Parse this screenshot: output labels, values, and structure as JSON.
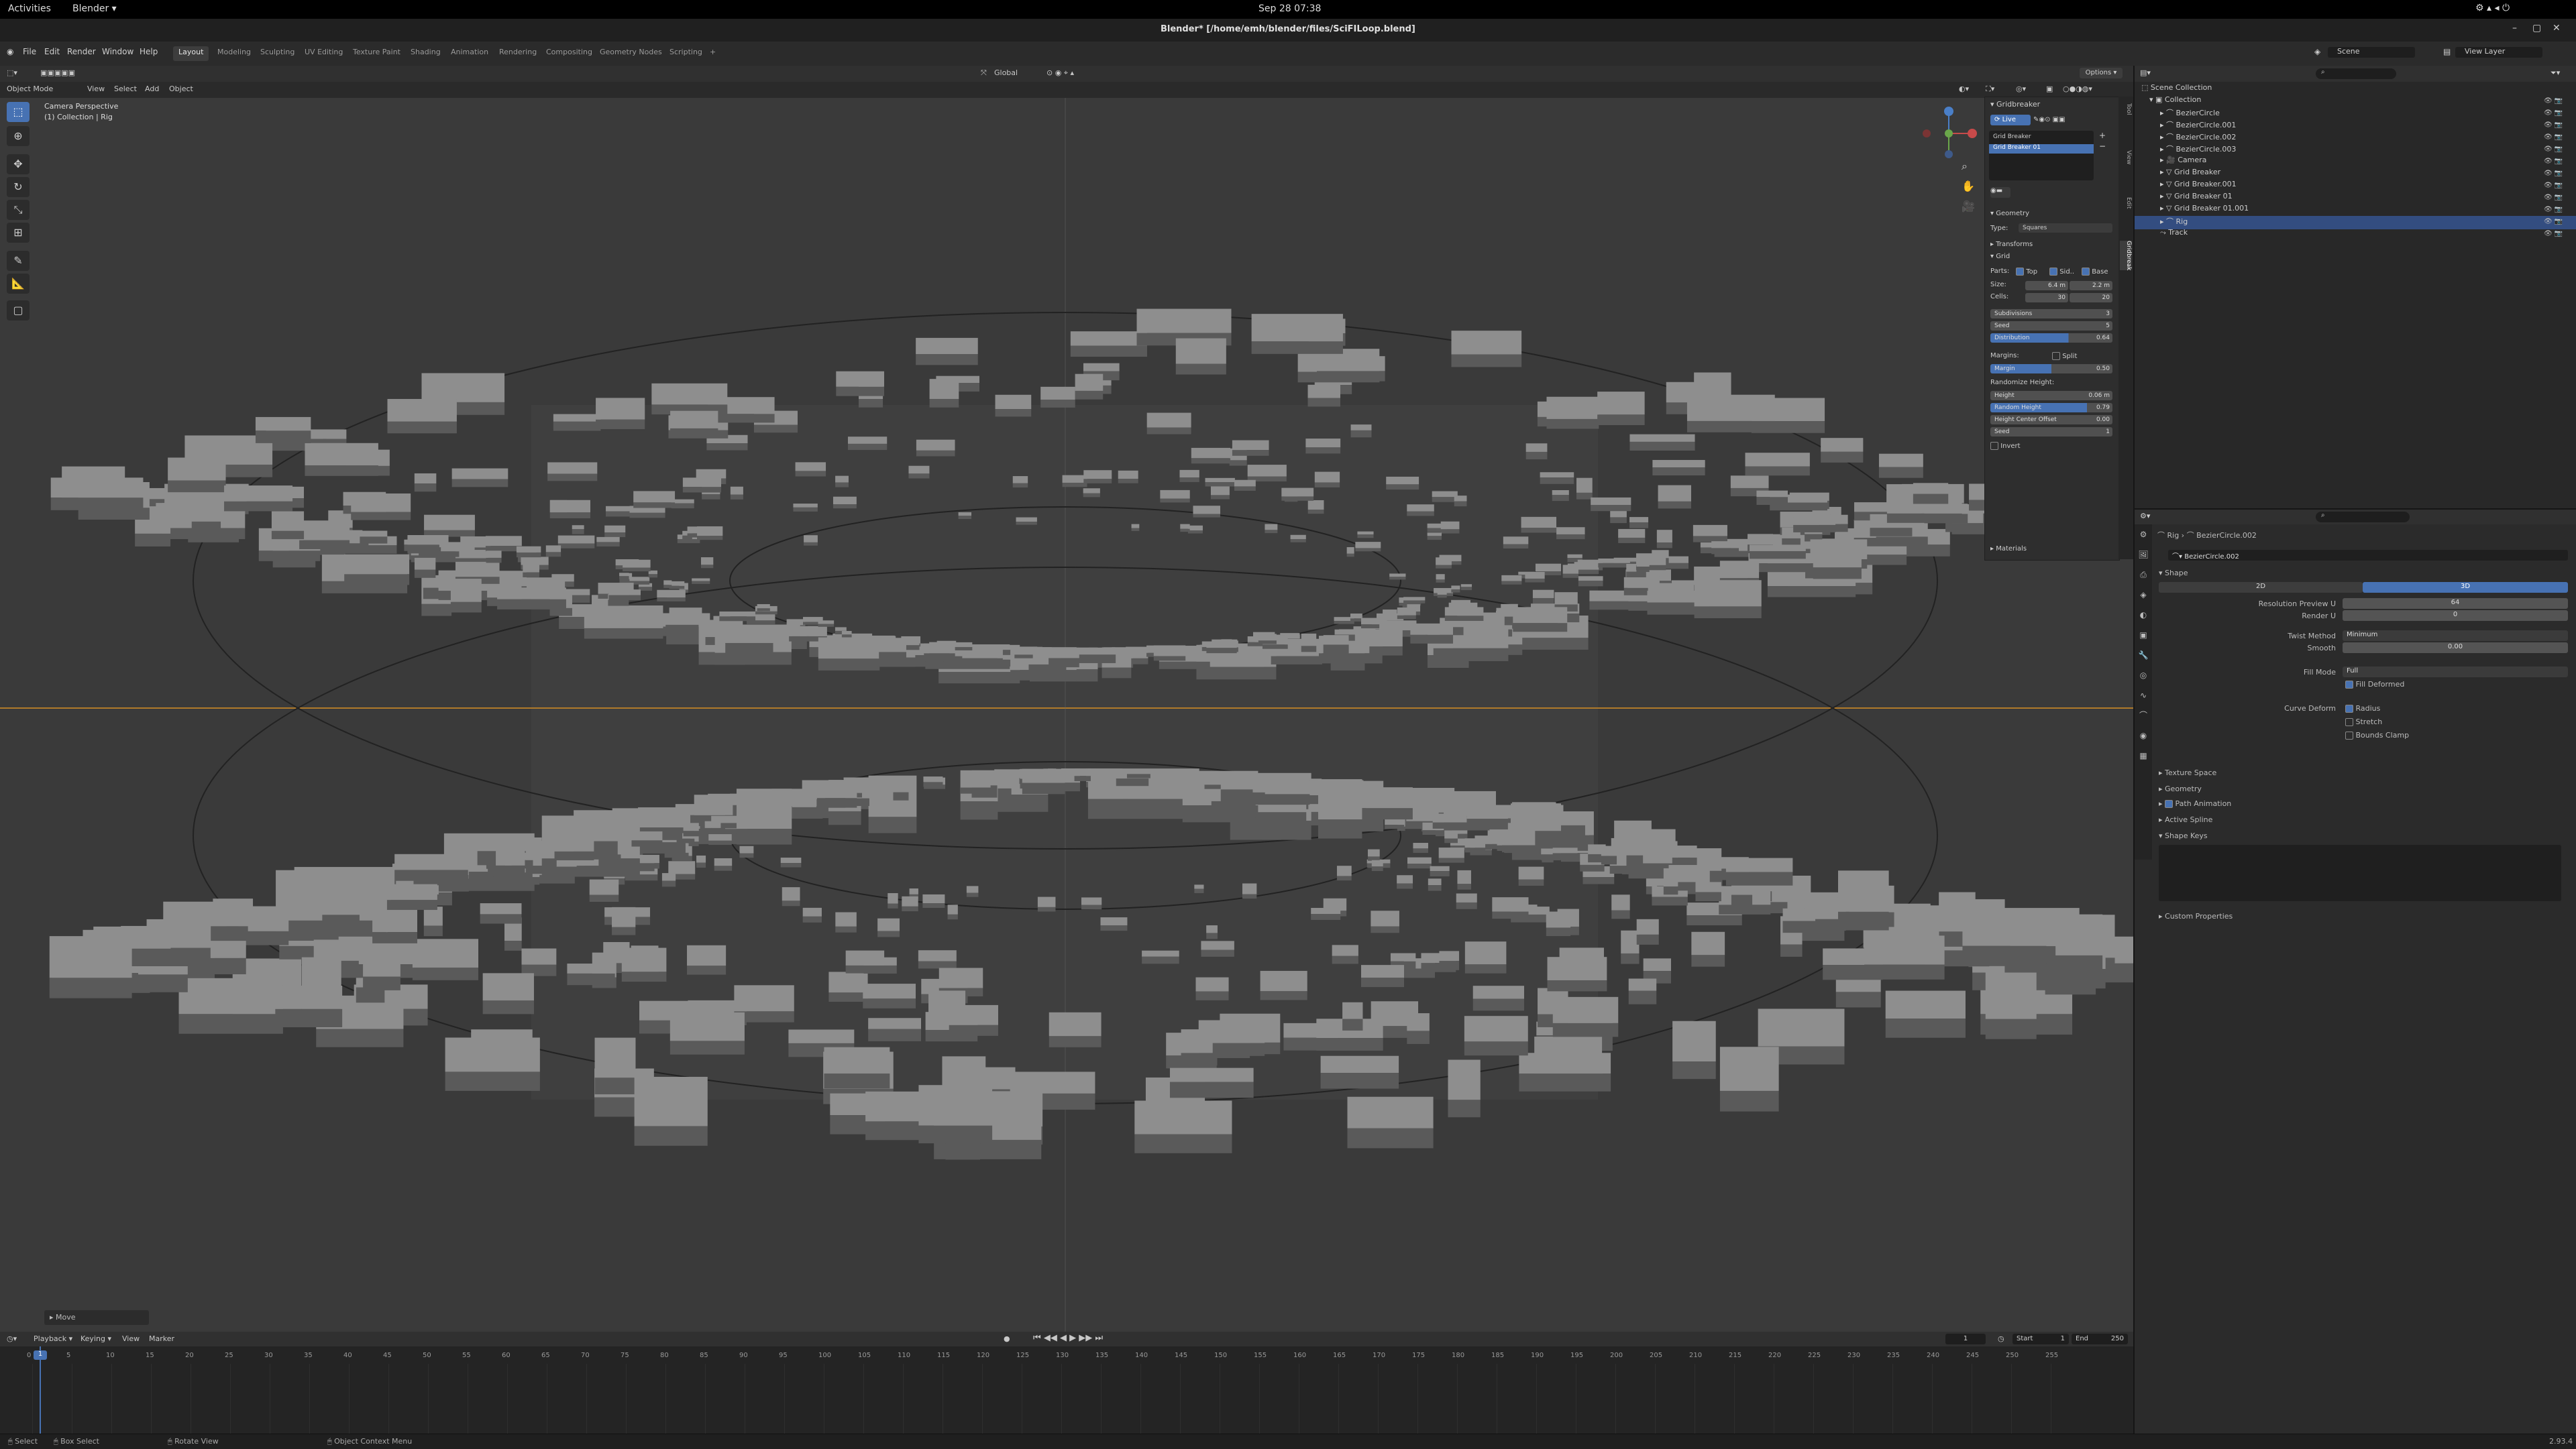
{
  "gnome": {
    "activities": "Activities",
    "app": "Blender ▾",
    "clock": "Sep 28  07:38"
  },
  "window": {
    "title": "Blender* [/home/emh/blender/files/SciFILoop.blend]"
  },
  "menu": {
    "items": [
      "File",
      "Edit",
      "Render",
      "Window",
      "Help"
    ]
  },
  "workspaces": [
    "Layout",
    "Modeling",
    "Sculpting",
    "UV Editing",
    "Texture Paint",
    "Shading",
    "Animation",
    "Rendering",
    "Compositing",
    "Geometry Nodes",
    "Scripting"
  ],
  "scene_selector": {
    "scene": "Scene",
    "view_layer": "View Layer"
  },
  "header3d": {
    "mode": "Object Mode",
    "view": "View",
    "select": "Select",
    "add": "Add",
    "object": "Object",
    "orientation": "Global",
    "options": "Options ▾"
  },
  "viewport": {
    "camera_label": "Camera Perspective",
    "collection_label": "(1) Collection | Rig",
    "last_op": "Move"
  },
  "npanel": {
    "title": "Gridbreaker",
    "live": "Live",
    "list": [
      "Grid Breaker",
      "Grid Breaker 01"
    ],
    "geometry": "Geometry",
    "type_label": "Type:",
    "type_value": "Squares",
    "transforms": "Transforms",
    "grid": "Grid",
    "parts_label": "Parts:",
    "parts": [
      "Top",
      "Sid..",
      "Base"
    ],
    "size_label": "Size:",
    "size": [
      "6.4 m",
      "2.2 m"
    ],
    "cells_label": "Cells:",
    "cells": [
      "30",
      "20"
    ],
    "subdivisions_label": "Subdivisions",
    "subdivisions": "3",
    "seed_label": "Seed",
    "seed": "5",
    "distribution_label": "Distribution",
    "distribution": "0.64",
    "margins_label": "Margins:",
    "split": "Split",
    "margin_label": "Margin",
    "margin": "0.50",
    "randomize_height": "Randomize Height:",
    "height_label": "Height",
    "height": "0.06 m",
    "random_height_label": "Random Height",
    "random_height": "0.79",
    "height_center_label": "Height Center Offset",
    "height_center": "0.00",
    "seed2_label": "Seed",
    "seed2": "1",
    "invert": "Invert",
    "materials": "Materials",
    "tabs": [
      "Tool",
      "View",
      "Edit",
      "Gridbreak"
    ]
  },
  "outliner": {
    "scene_collection": "Scene Collection",
    "rows": [
      "Collection",
      "BezierCircle",
      "BezierCircle.001",
      "BezierCircle.002",
      "BezierCircle.003",
      "Camera",
      "Grid Breaker",
      "Grid Breaker.001",
      "Grid Breaker 01",
      "Grid Breaker 01.001",
      "Rig",
      "Track"
    ]
  },
  "properties": {
    "breadcrumb_obj": "Rig",
    "breadcrumb_data": "BezierCircle.002",
    "datablock": "BezierCircle.002",
    "shape": "Shape",
    "dim2d": "2D",
    "dim3d": "3D",
    "res_preview_label": "Resolution Preview U",
    "res_preview": "64",
    "render_u_label": "Render U",
    "render_u": "0",
    "twist_label": "Twist Method",
    "twist": "Minimum",
    "smooth_label": "Smooth",
    "smooth": "0.00",
    "fill_label": "Fill Mode",
    "fill": "Full",
    "fill_deformed": "Fill Deformed",
    "curve_deform_label": "Curve Deform",
    "radius": "Radius",
    "stretch": "Stretch",
    "bounds_clamp": "Bounds Clamp",
    "panels": [
      "Texture Space",
      "Geometry",
      "Path Animation",
      "Active Spline",
      "Shape Keys",
      "Custom Properties"
    ]
  },
  "timeline": {
    "menus": [
      "Playback ▾",
      "Keying ▾",
      "View",
      "Marker"
    ],
    "current_frame": "1",
    "start_label": "Start",
    "start": "1",
    "end_label": "End",
    "end": "250",
    "ticks": [
      "0",
      "5",
      "10",
      "15",
      "20",
      "25",
      "30",
      "35",
      "40",
      "45",
      "50",
      "55",
      "60",
      "65",
      "70",
      "75",
      "80",
      "85",
      "90",
      "95",
      "100",
      "105",
      "110",
      "115",
      "120",
      "125",
      "130",
      "135",
      "140",
      "145",
      "150",
      "155",
      "160",
      "165",
      "170",
      "175",
      "180",
      "185",
      "190",
      "195",
      "200",
      "205",
      "210",
      "215",
      "220",
      "225",
      "230",
      "235",
      "240",
      "245",
      "250",
      "255"
    ]
  },
  "status": {
    "select": "Select",
    "box_select": "Box Select",
    "rotate_view": "Rotate View",
    "context_menu": "Object Context Menu",
    "version": "2.93.4"
  },
  "colors": {
    "accent": "#4772b3",
    "selection": "#334d80",
    "timeline_cursor": "#4772b3",
    "horizon": "#b07a2a"
  }
}
